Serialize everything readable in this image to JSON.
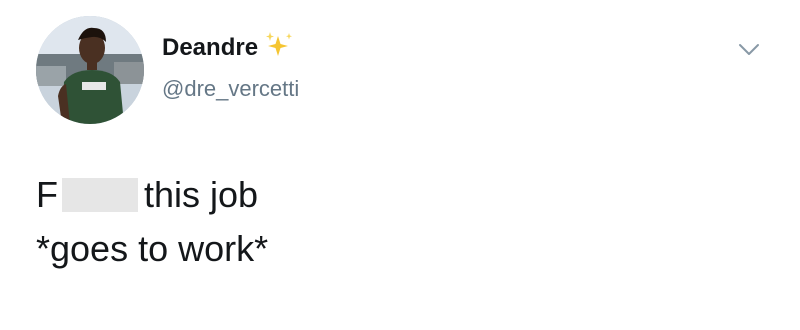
{
  "author": {
    "display_name": "Deandre",
    "handle": "@dre_vercetti",
    "avatar_icon": "profile-photo",
    "name_emoji_icon": "sparkles-icon"
  },
  "tweet": {
    "line1_prefix": "F",
    "line1_suffix": "this job",
    "line2": "*goes to work*"
  },
  "menu": {
    "icon": "chevron-down-icon"
  },
  "colors": {
    "text": "#14171a",
    "handle": "#657786",
    "caret": "#8899a6",
    "sparkle": "#f5c531",
    "censor": "#e6e6e6"
  }
}
